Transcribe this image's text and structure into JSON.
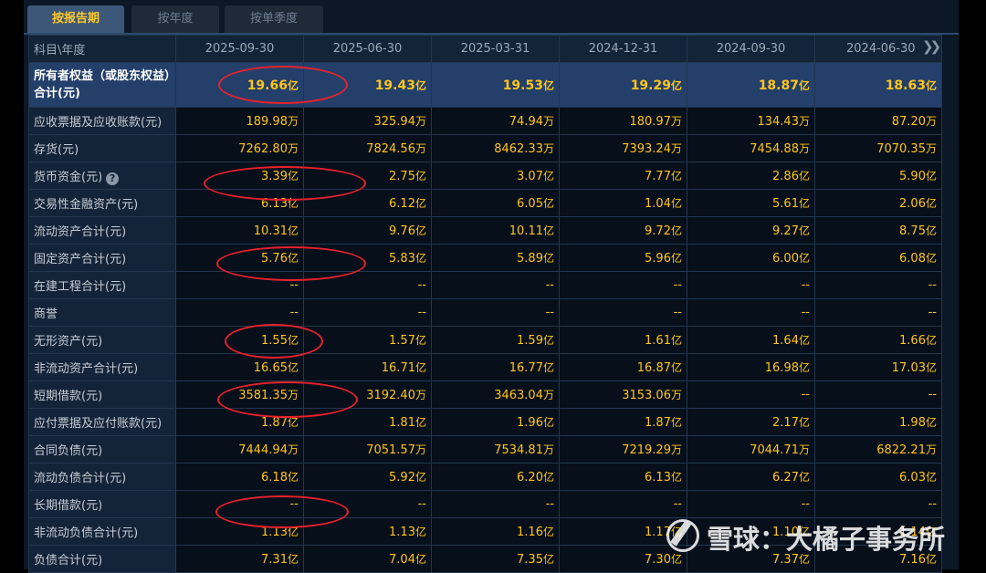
{
  "tabs": [
    {
      "label": "按报告期",
      "active": true
    },
    {
      "label": "按年度",
      "active": false
    },
    {
      "label": "按单季度",
      "active": false
    }
  ],
  "table": {
    "corner": "科目\\年度",
    "columns": [
      "2025-09-30",
      "2025-06-30",
      "2025-03-31",
      "2024-12-31",
      "2024-09-30",
      "2024-06-30"
    ],
    "rows": [
      {
        "label": "所有者权益（或股东权益）合计(元)",
        "values": [
          [
            "19.66",
            "亿"
          ],
          [
            "19.43",
            "亿"
          ],
          [
            "19.53",
            "亿"
          ],
          [
            "19.29",
            "亿"
          ],
          [
            "18.87",
            "亿"
          ],
          [
            "18.63",
            "亿"
          ]
        ]
      },
      {
        "label": "应收票据及应收账款(元)",
        "values": [
          [
            "189.98",
            "万"
          ],
          [
            "325.94",
            "万"
          ],
          [
            "74.94",
            "万"
          ],
          [
            "180.97",
            "万"
          ],
          [
            "134.43",
            "万"
          ],
          [
            "87.20",
            "万"
          ]
        ]
      },
      {
        "label": "存货(元)",
        "values": [
          [
            "7262.80",
            "万"
          ],
          [
            "7824.56",
            "万"
          ],
          [
            "8462.33",
            "万"
          ],
          [
            "7393.24",
            "万"
          ],
          [
            "7454.88",
            "万"
          ],
          [
            "7070.35",
            "万"
          ]
        ]
      },
      {
        "label": "货币资金(元)",
        "values": [
          [
            "3.39",
            "亿"
          ],
          [
            "2.75",
            "亿"
          ],
          [
            "3.07",
            "亿"
          ],
          [
            "7.77",
            "亿"
          ],
          [
            "2.86",
            "亿"
          ],
          [
            "5.90",
            "亿"
          ]
        ]
      },
      {
        "label": "交易性金融资产(元)",
        "values": [
          [
            "6.13",
            "亿"
          ],
          [
            "6.12",
            "亿"
          ],
          [
            "6.05",
            "亿"
          ],
          [
            "1.04",
            "亿"
          ],
          [
            "5.61",
            "亿"
          ],
          [
            "2.06",
            "亿"
          ]
        ]
      },
      {
        "label": "流动资产合计(元)",
        "values": [
          [
            "10.31",
            "亿"
          ],
          [
            "9.76",
            "亿"
          ],
          [
            "10.11",
            "亿"
          ],
          [
            "9.72",
            "亿"
          ],
          [
            "9.27",
            "亿"
          ],
          [
            "8.75",
            "亿"
          ]
        ]
      },
      {
        "label": "固定资产合计(元)",
        "values": [
          [
            "5.76",
            "亿"
          ],
          [
            "5.83",
            "亿"
          ],
          [
            "5.89",
            "亿"
          ],
          [
            "5.96",
            "亿"
          ],
          [
            "6.00",
            "亿"
          ],
          [
            "6.08",
            "亿"
          ]
        ]
      },
      {
        "label": "在建工程合计(元)",
        "values": [
          [
            "--",
            ""
          ],
          [
            "--",
            ""
          ],
          [
            "--",
            ""
          ],
          [
            "--",
            ""
          ],
          [
            "--",
            ""
          ],
          [
            "--",
            ""
          ]
        ]
      },
      {
        "label": "商誉",
        "values": [
          [
            "--",
            ""
          ],
          [
            "--",
            ""
          ],
          [
            "--",
            ""
          ],
          [
            "--",
            ""
          ],
          [
            "--",
            ""
          ],
          [
            "--",
            ""
          ]
        ]
      },
      {
        "label": "无形资产(元)",
        "values": [
          [
            "1.55",
            "亿"
          ],
          [
            "1.57",
            "亿"
          ],
          [
            "1.59",
            "亿"
          ],
          [
            "1.61",
            "亿"
          ],
          [
            "1.64",
            "亿"
          ],
          [
            "1.66",
            "亿"
          ]
        ]
      },
      {
        "label": "非流动资产合计(元)",
        "values": [
          [
            "16.65",
            "亿"
          ],
          [
            "16.71",
            "亿"
          ],
          [
            "16.77",
            "亿"
          ],
          [
            "16.87",
            "亿"
          ],
          [
            "16.98",
            "亿"
          ],
          [
            "17.03",
            "亿"
          ]
        ]
      },
      {
        "label": "短期借款(元)",
        "values": [
          [
            "3581.35",
            "万"
          ],
          [
            "3192.40",
            "万"
          ],
          [
            "3463.04",
            "万"
          ],
          [
            "3153.06",
            "万"
          ],
          [
            "--",
            ""
          ],
          [
            "--",
            ""
          ]
        ]
      },
      {
        "label": "应付票据及应付账款(元)",
        "values": [
          [
            "1.87",
            "亿"
          ],
          [
            "1.81",
            "亿"
          ],
          [
            "1.96",
            "亿"
          ],
          [
            "1.87",
            "亿"
          ],
          [
            "2.17",
            "亿"
          ],
          [
            "1.98",
            "亿"
          ]
        ]
      },
      {
        "label": "合同负债(元)",
        "values": [
          [
            "7444.94",
            "万"
          ],
          [
            "7051.57",
            "万"
          ],
          [
            "7534.81",
            "万"
          ],
          [
            "7219.29",
            "万"
          ],
          [
            "7044.71",
            "万"
          ],
          [
            "6822.21",
            "万"
          ]
        ]
      },
      {
        "label": "流动负债合计(元)",
        "values": [
          [
            "6.18",
            "亿"
          ],
          [
            "5.92",
            "亿"
          ],
          [
            "6.20",
            "亿"
          ],
          [
            "6.13",
            "亿"
          ],
          [
            "6.27",
            "亿"
          ],
          [
            "6.03",
            "亿"
          ]
        ]
      },
      {
        "label": "长期借款(元)",
        "values": [
          [
            "--",
            ""
          ],
          [
            "--",
            ""
          ],
          [
            "--",
            ""
          ],
          [
            "--",
            ""
          ],
          [
            "--",
            ""
          ],
          [
            "--",
            ""
          ]
        ]
      },
      {
        "label": "非流动负债合计(元)",
        "values": [
          [
            "1.13",
            "亿"
          ],
          [
            "1.13",
            "亿"
          ],
          [
            "1.16",
            "亿"
          ],
          [
            "1.17",
            "亿"
          ],
          [
            "1.10",
            "亿"
          ],
          [
            "1.14",
            "亿"
          ]
        ]
      },
      {
        "label": "负债合计(元)",
        "values": [
          [
            "7.31",
            "亿"
          ],
          [
            "7.04",
            "亿"
          ],
          [
            "7.35",
            "亿"
          ],
          [
            "7.30",
            "亿"
          ],
          [
            "7.37",
            "亿"
          ],
          [
            "7.16",
            "亿"
          ]
        ]
      }
    ]
  },
  "watermark": "雪球：大橘子事务所",
  "colors": {
    "value": "#ffc61a",
    "highlight_row": "#233f6a",
    "annotation": "#e8212b"
  }
}
